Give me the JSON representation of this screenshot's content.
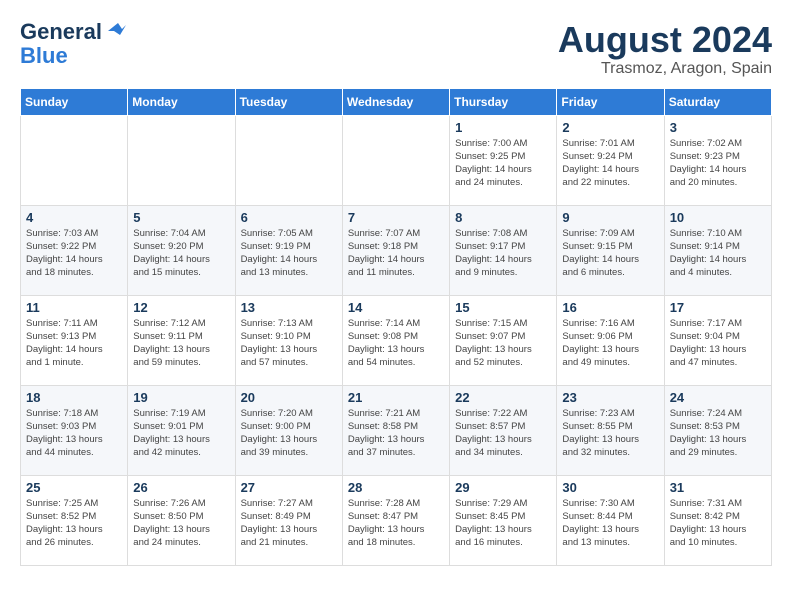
{
  "logo": {
    "general": "General",
    "blue": "Blue"
  },
  "title": "August 2024",
  "subtitle": "Trasmoz, Aragon, Spain",
  "headers": [
    "Sunday",
    "Monday",
    "Tuesday",
    "Wednesday",
    "Thursday",
    "Friday",
    "Saturday"
  ],
  "weeks": [
    [
      {
        "day": "",
        "info": ""
      },
      {
        "day": "",
        "info": ""
      },
      {
        "day": "",
        "info": ""
      },
      {
        "day": "",
        "info": ""
      },
      {
        "day": "1",
        "info": "Sunrise: 7:00 AM\nSunset: 9:25 PM\nDaylight: 14 hours\nand 24 minutes."
      },
      {
        "day": "2",
        "info": "Sunrise: 7:01 AM\nSunset: 9:24 PM\nDaylight: 14 hours\nand 22 minutes."
      },
      {
        "day": "3",
        "info": "Sunrise: 7:02 AM\nSunset: 9:23 PM\nDaylight: 14 hours\nand 20 minutes."
      }
    ],
    [
      {
        "day": "4",
        "info": "Sunrise: 7:03 AM\nSunset: 9:22 PM\nDaylight: 14 hours\nand 18 minutes."
      },
      {
        "day": "5",
        "info": "Sunrise: 7:04 AM\nSunset: 9:20 PM\nDaylight: 14 hours\nand 15 minutes."
      },
      {
        "day": "6",
        "info": "Sunrise: 7:05 AM\nSunset: 9:19 PM\nDaylight: 14 hours\nand 13 minutes."
      },
      {
        "day": "7",
        "info": "Sunrise: 7:07 AM\nSunset: 9:18 PM\nDaylight: 14 hours\nand 11 minutes."
      },
      {
        "day": "8",
        "info": "Sunrise: 7:08 AM\nSunset: 9:17 PM\nDaylight: 14 hours\nand 9 minutes."
      },
      {
        "day": "9",
        "info": "Sunrise: 7:09 AM\nSunset: 9:15 PM\nDaylight: 14 hours\nand 6 minutes."
      },
      {
        "day": "10",
        "info": "Sunrise: 7:10 AM\nSunset: 9:14 PM\nDaylight: 14 hours\nand 4 minutes."
      }
    ],
    [
      {
        "day": "11",
        "info": "Sunrise: 7:11 AM\nSunset: 9:13 PM\nDaylight: 14 hours\nand 1 minute."
      },
      {
        "day": "12",
        "info": "Sunrise: 7:12 AM\nSunset: 9:11 PM\nDaylight: 13 hours\nand 59 minutes."
      },
      {
        "day": "13",
        "info": "Sunrise: 7:13 AM\nSunset: 9:10 PM\nDaylight: 13 hours\nand 57 minutes."
      },
      {
        "day": "14",
        "info": "Sunrise: 7:14 AM\nSunset: 9:08 PM\nDaylight: 13 hours\nand 54 minutes."
      },
      {
        "day": "15",
        "info": "Sunrise: 7:15 AM\nSunset: 9:07 PM\nDaylight: 13 hours\nand 52 minutes."
      },
      {
        "day": "16",
        "info": "Sunrise: 7:16 AM\nSunset: 9:06 PM\nDaylight: 13 hours\nand 49 minutes."
      },
      {
        "day": "17",
        "info": "Sunrise: 7:17 AM\nSunset: 9:04 PM\nDaylight: 13 hours\nand 47 minutes."
      }
    ],
    [
      {
        "day": "18",
        "info": "Sunrise: 7:18 AM\nSunset: 9:03 PM\nDaylight: 13 hours\nand 44 minutes."
      },
      {
        "day": "19",
        "info": "Sunrise: 7:19 AM\nSunset: 9:01 PM\nDaylight: 13 hours\nand 42 minutes."
      },
      {
        "day": "20",
        "info": "Sunrise: 7:20 AM\nSunset: 9:00 PM\nDaylight: 13 hours\nand 39 minutes."
      },
      {
        "day": "21",
        "info": "Sunrise: 7:21 AM\nSunset: 8:58 PM\nDaylight: 13 hours\nand 37 minutes."
      },
      {
        "day": "22",
        "info": "Sunrise: 7:22 AM\nSunset: 8:57 PM\nDaylight: 13 hours\nand 34 minutes."
      },
      {
        "day": "23",
        "info": "Sunrise: 7:23 AM\nSunset: 8:55 PM\nDaylight: 13 hours\nand 32 minutes."
      },
      {
        "day": "24",
        "info": "Sunrise: 7:24 AM\nSunset: 8:53 PM\nDaylight: 13 hours\nand 29 minutes."
      }
    ],
    [
      {
        "day": "25",
        "info": "Sunrise: 7:25 AM\nSunset: 8:52 PM\nDaylight: 13 hours\nand 26 minutes."
      },
      {
        "day": "26",
        "info": "Sunrise: 7:26 AM\nSunset: 8:50 PM\nDaylight: 13 hours\nand 24 minutes."
      },
      {
        "day": "27",
        "info": "Sunrise: 7:27 AM\nSunset: 8:49 PM\nDaylight: 13 hours\nand 21 minutes."
      },
      {
        "day": "28",
        "info": "Sunrise: 7:28 AM\nSunset: 8:47 PM\nDaylight: 13 hours\nand 18 minutes."
      },
      {
        "day": "29",
        "info": "Sunrise: 7:29 AM\nSunset: 8:45 PM\nDaylight: 13 hours\nand 16 minutes."
      },
      {
        "day": "30",
        "info": "Sunrise: 7:30 AM\nSunset: 8:44 PM\nDaylight: 13 hours\nand 13 minutes."
      },
      {
        "day": "31",
        "info": "Sunrise: 7:31 AM\nSunset: 8:42 PM\nDaylight: 13 hours\nand 10 minutes."
      }
    ]
  ]
}
